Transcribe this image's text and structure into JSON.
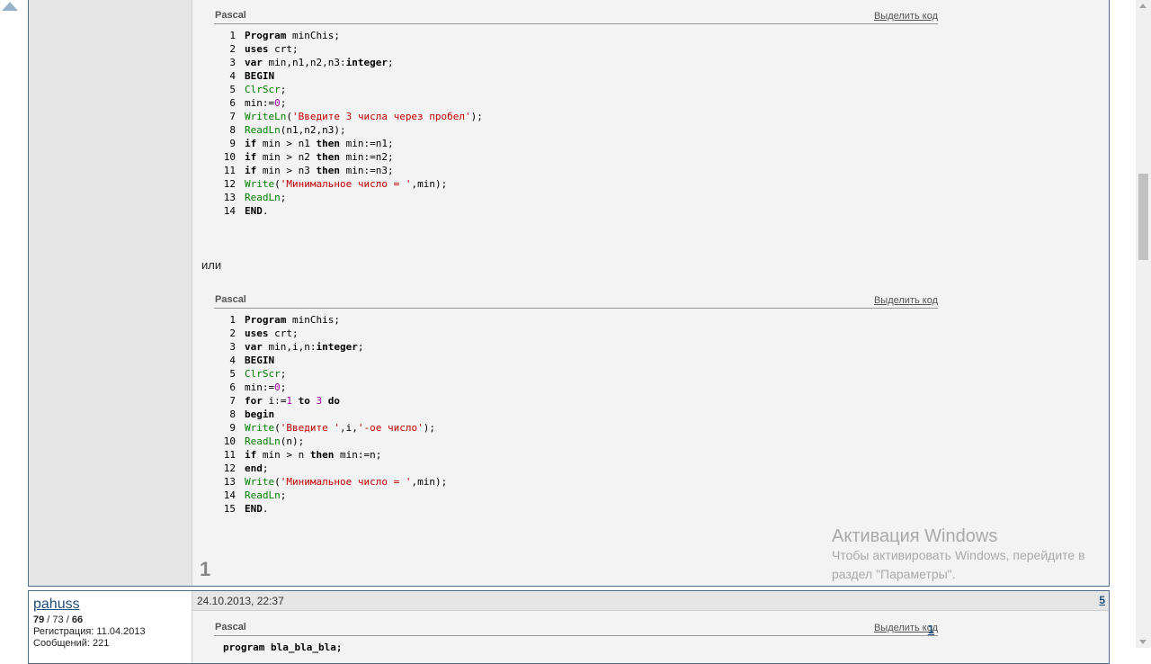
{
  "post": {
    "code_blocks": [
      {
        "lang": "Pascal",
        "select_label": "Выделить код",
        "lines": [
          {
            "n": "1",
            "segs": [
              {
                "k": "kw",
                "t": "Program"
              },
              {
                "k": "",
                "t": " minChis;"
              }
            ]
          },
          {
            "n": "2",
            "segs": [
              {
                "k": "kw",
                "t": "uses"
              },
              {
                "k": "",
                "t": " crt;"
              }
            ]
          },
          {
            "n": "3",
            "segs": [
              {
                "k": "kw",
                "t": "var"
              },
              {
                "k": "",
                "t": " min,n1,n2,n3:"
              },
              {
                "k": "kw",
                "t": "integer"
              },
              {
                "k": "",
                "t": ";"
              }
            ]
          },
          {
            "n": "4",
            "segs": [
              {
                "k": "kw",
                "t": "BEGIN"
              }
            ]
          },
          {
            "n": "5",
            "segs": [
              {
                "k": "fn",
                "t": "ClrScr"
              },
              {
                "k": "",
                "t": ";"
              }
            ]
          },
          {
            "n": "6",
            "segs": [
              {
                "k": "",
                "t": "min:="
              },
              {
                "k": "nm",
                "t": "0"
              },
              {
                "k": "",
                "t": ";"
              }
            ]
          },
          {
            "n": "7",
            "segs": [
              {
                "k": "fn",
                "t": "WriteLn"
              },
              {
                "k": "",
                "t": "("
              },
              {
                "k": "st",
                "t": "'Введите 3 числа через пробел'"
              },
              {
                "k": "",
                "t": ");"
              }
            ]
          },
          {
            "n": "8",
            "segs": [
              {
                "k": "fn",
                "t": "ReadLn"
              },
              {
                "k": "",
                "t": "(n1,n2,n3);"
              }
            ]
          },
          {
            "n": "9",
            "segs": [
              {
                "k": "kw",
                "t": "if"
              },
              {
                "k": "",
                "t": " min > n1 "
              },
              {
                "k": "kw",
                "t": "then"
              },
              {
                "k": "",
                "t": " min:=n1;"
              }
            ]
          },
          {
            "n": "10",
            "segs": [
              {
                "k": "kw",
                "t": "if"
              },
              {
                "k": "",
                "t": " min > n2 "
              },
              {
                "k": "kw",
                "t": "then"
              },
              {
                "k": "",
                "t": " min:=n2;"
              }
            ]
          },
          {
            "n": "11",
            "segs": [
              {
                "k": "kw",
                "t": "if"
              },
              {
                "k": "",
                "t": " min > n3 "
              },
              {
                "k": "kw",
                "t": "then"
              },
              {
                "k": "",
                "t": " min:=n3;"
              }
            ]
          },
          {
            "n": "12",
            "segs": [
              {
                "k": "fn",
                "t": "Write"
              },
              {
                "k": "",
                "t": "("
              },
              {
                "k": "st",
                "t": "'Минимальное число = '"
              },
              {
                "k": "",
                "t": ",min);"
              }
            ]
          },
          {
            "n": "13",
            "segs": [
              {
                "k": "fn",
                "t": "ReadLn"
              },
              {
                "k": "",
                "t": ";"
              }
            ]
          },
          {
            "n": "14",
            "segs": [
              {
                "k": "kw",
                "t": "END"
              },
              {
                "k": "",
                "t": "."
              }
            ]
          }
        ]
      },
      {
        "lang": "Pascal",
        "select_label": "Выделить код",
        "lines": [
          {
            "n": "1",
            "segs": [
              {
                "k": "kw",
                "t": "Program"
              },
              {
                "k": "",
                "t": " minChis;"
              }
            ]
          },
          {
            "n": "2",
            "segs": [
              {
                "k": "kw",
                "t": "uses"
              },
              {
                "k": "",
                "t": " crt;"
              }
            ]
          },
          {
            "n": "3",
            "segs": [
              {
                "k": "kw",
                "t": "var"
              },
              {
                "k": "",
                "t": " min,i,n:"
              },
              {
                "k": "kw",
                "t": "integer"
              },
              {
                "k": "",
                "t": ";"
              }
            ]
          },
          {
            "n": "4",
            "segs": [
              {
                "k": "kw",
                "t": "BEGIN"
              }
            ]
          },
          {
            "n": "5",
            "segs": [
              {
                "k": "fn",
                "t": "ClrScr"
              },
              {
                "k": "",
                "t": ";"
              }
            ]
          },
          {
            "n": "6",
            "segs": [
              {
                "k": "",
                "t": "min:="
              },
              {
                "k": "nm",
                "t": "0"
              },
              {
                "k": "",
                "t": ";"
              }
            ]
          },
          {
            "n": "7",
            "segs": [
              {
                "k": "kw",
                "t": "for"
              },
              {
                "k": "",
                "t": " i:="
              },
              {
                "k": "nm",
                "t": "1"
              },
              {
                "k": "",
                "t": " "
              },
              {
                "k": "kw",
                "t": "to"
              },
              {
                "k": "",
                "t": " "
              },
              {
                "k": "nm",
                "t": "3"
              },
              {
                "k": "",
                "t": " "
              },
              {
                "k": "kw",
                "t": "do"
              }
            ]
          },
          {
            "n": "8",
            "segs": [
              {
                "k": "kw",
                "t": "begin"
              }
            ]
          },
          {
            "n": "9",
            "segs": [
              {
                "k": "fn",
                "t": "Write"
              },
              {
                "k": "",
                "t": "("
              },
              {
                "k": "st",
                "t": "'Введите '"
              },
              {
                "k": "",
                "t": ",i,"
              },
              {
                "k": "st",
                "t": "'-ое число'"
              },
              {
                "k": "",
                "t": ");"
              }
            ]
          },
          {
            "n": "10",
            "segs": [
              {
                "k": "fn",
                "t": "ReadLn"
              },
              {
                "k": "",
                "t": "(n);"
              }
            ]
          },
          {
            "n": "11",
            "segs": [
              {
                "k": "kw",
                "t": "if"
              },
              {
                "k": "",
                "t": " min > n "
              },
              {
                "k": "kw",
                "t": "then"
              },
              {
                "k": "",
                "t": " min:=n;"
              }
            ]
          },
          {
            "n": "12",
            "segs": [
              {
                "k": "kw",
                "t": "end"
              },
              {
                "k": "",
                "t": ";"
              }
            ]
          },
          {
            "n": "13",
            "segs": [
              {
                "k": "fn",
                "t": "Write"
              },
              {
                "k": "",
                "t": "("
              },
              {
                "k": "st",
                "t": "'Минимальное число = '"
              },
              {
                "k": "",
                "t": ",min);"
              }
            ]
          },
          {
            "n": "14",
            "segs": [
              {
                "k": "fn",
                "t": "ReadLn"
              },
              {
                "k": "",
                "t": ";"
              }
            ]
          },
          {
            "n": "15",
            "segs": [
              {
                "k": "kw",
                "t": "END"
              },
              {
                "k": "",
                "t": "."
              }
            ]
          }
        ]
      }
    ],
    "or_text": "или",
    "reputation": "1"
  },
  "activation": {
    "title": "Активация Windows",
    "line1": "Чтобы активировать Windows, перейдите в",
    "line2": "раздел \"Параметры\"."
  },
  "post2": {
    "username": "pahuss",
    "stats_a": "79",
    "sep1": " / ",
    "stats_b": "73",
    "sep2": " / ",
    "stats_c": "66",
    "registration": "Регистрация: 11.04.2013",
    "messages": "Сообщений: 221",
    "date": "24.10.2013, 22:37",
    "post_number": "5",
    "code_lang": "Pascal",
    "code_select": "Выделить код",
    "code_first_line_num": "1",
    "code_first_line": "program bla_bla_bla;"
  },
  "colors": {
    "border": "#4d6d8e",
    "link": "#1f4d7a",
    "string": "#c00000",
    "function": "#008000",
    "number": "#a000a0"
  }
}
